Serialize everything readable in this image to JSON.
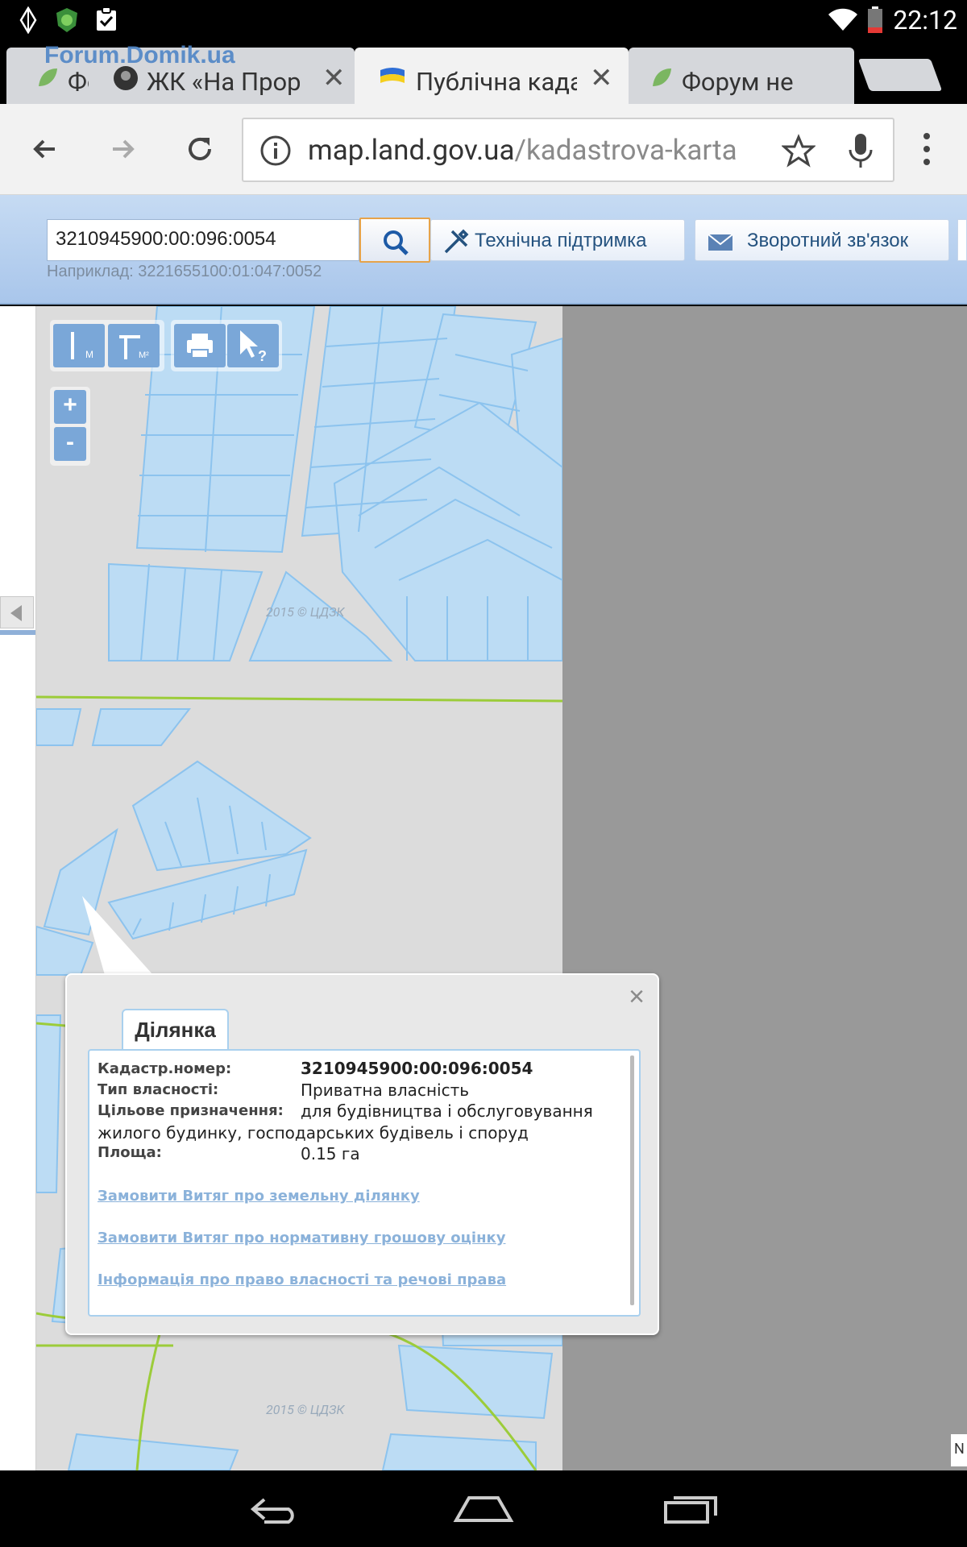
{
  "status_bar": {
    "time": "22:12",
    "icons": [
      "android-debug-icon",
      "security-shield-icon",
      "clipboard-check-icon",
      "wifi-icon",
      "battery-icon"
    ]
  },
  "tabs": [
    {
      "title": "Фо",
      "favicon": "leaf-icon",
      "active": false
    },
    {
      "title": "ЖК «На Прор",
      "favicon": "avatar-icon",
      "active": false
    },
    {
      "title": "Публічна када",
      "favicon": "ukraine-flag-icon",
      "active": true
    },
    {
      "title": "Форум не",
      "favicon": "leaf-icon",
      "active": false
    }
  ],
  "watermark_logo": "Forum.Domik.ua",
  "toolbar": {
    "url_host": "map.land.gov.ua",
    "url_path": "/kadastrova-karta"
  },
  "site_header": {
    "search_value": "3210945900:00:096:0054",
    "example": "Наприклад: 3221655100:01:047:0052",
    "support_label": "Технічна підтримка",
    "feedback_label": "Зворотний зв'язок"
  },
  "map": {
    "watermark": "2015 © ЦДЗК",
    "zoom_in": "+",
    "zoom_out": "-",
    "edge_text": "N"
  },
  "popup": {
    "tab_label": "Ділянка",
    "close": "×",
    "fields": {
      "cadastral_label": "Кадастр.номер:",
      "cadastral_value": "3210945900:00:096:0054",
      "ownership_label": "Тип власності:",
      "ownership_value": "Приватна власність",
      "purpose_label": "Цільове призначення:",
      "purpose_value_1": "для будівництва і обслуговування",
      "purpose_value_2": "жилого будинку, господарських будівель і споруд",
      "area_label": "Площа:",
      "area_value": "0.15 га"
    },
    "links": [
      "Замовити Витяг про земельну ділянку",
      "Замовити Витяг про нормативну грошову оцінку",
      "Інформація про право власності та речові права"
    ]
  }
}
